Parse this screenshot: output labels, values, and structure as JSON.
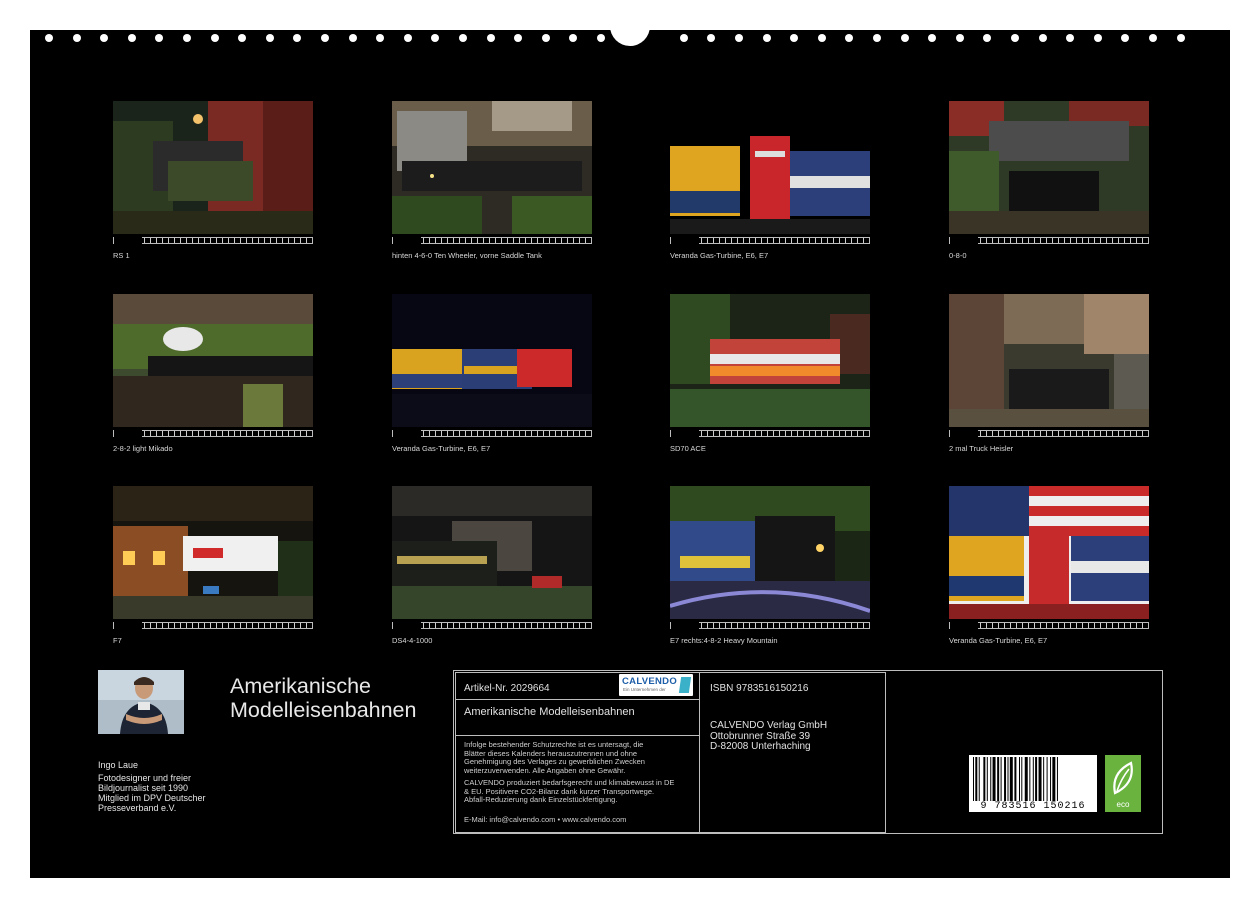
{
  "thumbnails": [
    {
      "caption": "RS 1"
    },
    {
      "caption": "hinten 4-6-0 Ten Wheeler, vorne Saddle Tank"
    },
    {
      "caption": "Veranda Gas-Turbine, E6, E7"
    },
    {
      "caption": "0-8-0"
    },
    {
      "caption": "2-8-2 light Mikado"
    },
    {
      "caption": "Veranda Gas-Turbine, E6, E7"
    },
    {
      "caption": "SD70 ACE"
    },
    {
      "caption": "2 mal Truck Heisler"
    },
    {
      "caption": "F7"
    },
    {
      "caption": "DS4-4-1000"
    },
    {
      "caption": "E7 rechts:4-8-2 Heavy Mountain"
    },
    {
      "caption": "Veranda Gas-Turbine, E6, E7"
    }
  ],
  "author": {
    "name": "Ingo Laue",
    "bio_lines": [
      "Fotodesigner und freier",
      "Bildjournalist seit 1990",
      "Mitglied im DPV Deutscher",
      "Presseverband e.V."
    ]
  },
  "title_lines": [
    "Amerikanische",
    "Modelleisenbahnen"
  ],
  "info": {
    "article": "Artikel-Nr. 2029664",
    "logo_word": "CALVENDO",
    "logo_sub": "Ein Unternehmen der",
    "title": "Amerikanische Modelleisenbahnen",
    "legal_1": [
      "Infolge bestehender Schutzrechte ist es untersagt, die",
      "Blätter dieses Kalenders herauszutrennen und ohne",
      "Genehmigung des Verlages zu gewerblichen Zwecken",
      "weiterzuverwenden. Alle Angaben ohne Gewähr."
    ],
    "legal_2": [
      "CALVENDO produziert bedarfsgerecht und klimabewusst in DE",
      "& EU. Positivere CO2-Bilanz dank kurzer Transportwege.",
      "Abfall-Reduzierung dank Einzelstückfertigung."
    ],
    "contact": "E-Mail: info@calvendo.com • www.calvendo.com",
    "isbn": "ISBN 9783516150216",
    "publisher_lines": [
      "CALVENDO Verlag GmbH",
      "Ottobrunner Straße 39",
      "D-82008 Unterhaching"
    ],
    "barcode_digits": "9 783516 150216",
    "eco_label": "eco"
  }
}
